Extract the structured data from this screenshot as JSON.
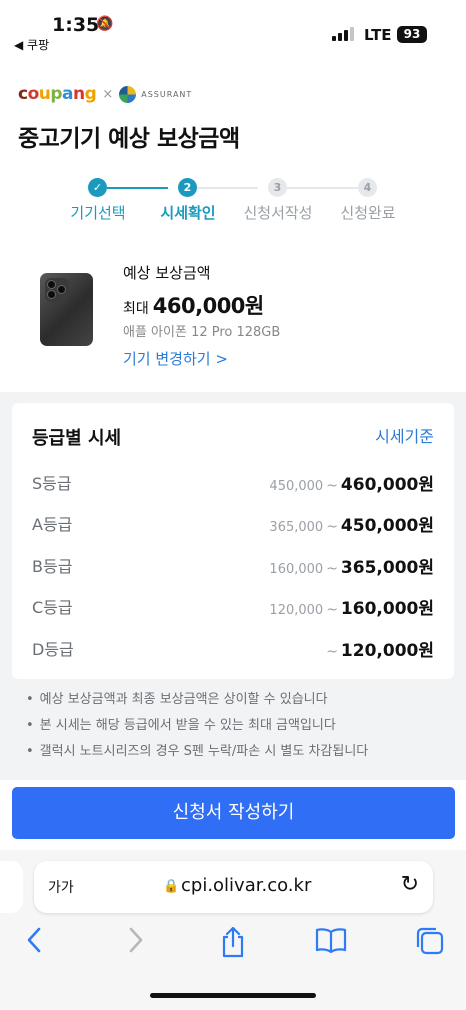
{
  "status_bar": {
    "time": "1:35",
    "back_label": "◀ 쿠팡",
    "network": "LTE",
    "battery": "93"
  },
  "brand": {
    "coupang": [
      "c",
      "o",
      "u",
      "p",
      "a",
      "n",
      "g"
    ],
    "separator": "×",
    "partner": "ASSURANT"
  },
  "page_title": "중고기기 예상 보상금액",
  "steps": [
    {
      "num": "✓",
      "label": "기기선택",
      "state": "done"
    },
    {
      "num": "2",
      "label": "시세확인",
      "state": "active"
    },
    {
      "num": "3",
      "label": "신청서작성",
      "state": "todo"
    },
    {
      "num": "4",
      "label": "신청완료",
      "state": "todo"
    }
  ],
  "device": {
    "estimate_label": "예상 보상금액",
    "max_prefix": "최대",
    "max_price": "460,000원",
    "model": "애플 아이폰 12 Pro 128GB",
    "change_link": "기기 변경하기 >"
  },
  "grade_card": {
    "title": "등급별 시세",
    "link": "시세기준",
    "rows": [
      {
        "grade": "S등급",
        "low": "450,000",
        "high": "460,000원"
      },
      {
        "grade": "A등급",
        "low": "365,000",
        "high": "450,000원"
      },
      {
        "grade": "B등급",
        "low": "160,000",
        "high": "365,000원"
      },
      {
        "grade": "C등급",
        "low": "120,000",
        "high": "160,000원"
      },
      {
        "grade": "D등급",
        "low": "",
        "high": "120,000원"
      }
    ],
    "tilde": "~"
  },
  "notes": [
    "예상 보상금액과 최종 보상금액은 상이할 수 있습니다",
    "본 시세는 해당 등급에서 받을 수 있는 최대 금액입니다",
    "갤럭시 노트시리즈의 경우 S펜 누락/파손 시 별도 차감됩니다"
  ],
  "cta_label": "신청서 작성하기",
  "browser": {
    "text_size": "가가",
    "url": "cpi.olivar.co.kr"
  },
  "colors": {
    "accent": "#1a9bbd",
    "primary_button": "#2f6ef5",
    "link": "#2b7bd9"
  }
}
